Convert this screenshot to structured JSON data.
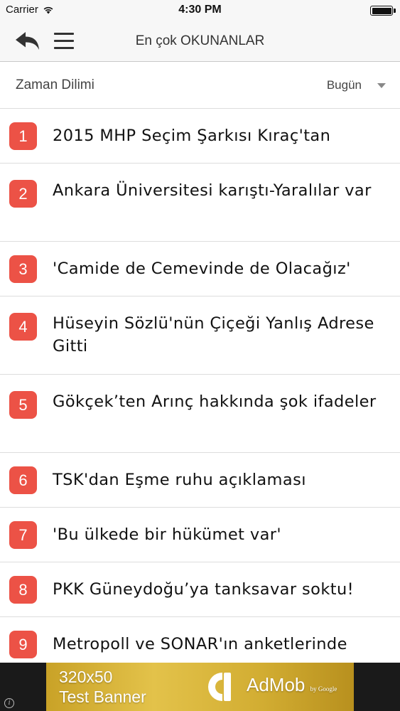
{
  "status_bar": {
    "carrier": "Carrier",
    "time": "4:30 PM",
    "battery_level": 1.0
  },
  "nav": {
    "title": "En çok OKUNANLAR",
    "back_icon": "back-arrow-icon",
    "menu_icon": "hamburger-menu-icon"
  },
  "filter": {
    "label": "Zaman Dilimi",
    "selected": "Bugün",
    "caret_icon": "caret-down-icon"
  },
  "news": [
    {
      "rank": "1",
      "title": "2015 MHP Seçim Şarkısı Kıraç'tan"
    },
    {
      "rank": "2",
      "title": "Ankara Üniversitesi karıştı-Yaralılar var"
    },
    {
      "rank": "3",
      "title": "'Camide de Cemevinde de Olacağız'"
    },
    {
      "rank": "4",
      "title": "Hüseyin Sözlü'nün Çiçeği Yanlış Adrese Gitti"
    },
    {
      "rank": "5",
      "title": "Gökçek’ten Arınç hakkında şok ifadeler"
    },
    {
      "rank": "6",
      "title": "TSK'dan Eşme ruhu açıklaması"
    },
    {
      "rank": "7",
      "title": "'Bu ülkede bir hükümet var'"
    },
    {
      "rank": "8",
      "title": "PKK Güneydoğu’ya tanksavar soktu!"
    },
    {
      "rank": "9",
      "title": "Metropoll ve SONAR'ın anketlerinde"
    }
  ],
  "ad": {
    "size": "320x50",
    "text": "Test Banner",
    "brand": "AdMob",
    "brand_sub": "by Google",
    "info": "i"
  },
  "colors": {
    "badge": "#ec5246",
    "nav_bg": "#f7f7f7",
    "divider": "#dddddd"
  }
}
